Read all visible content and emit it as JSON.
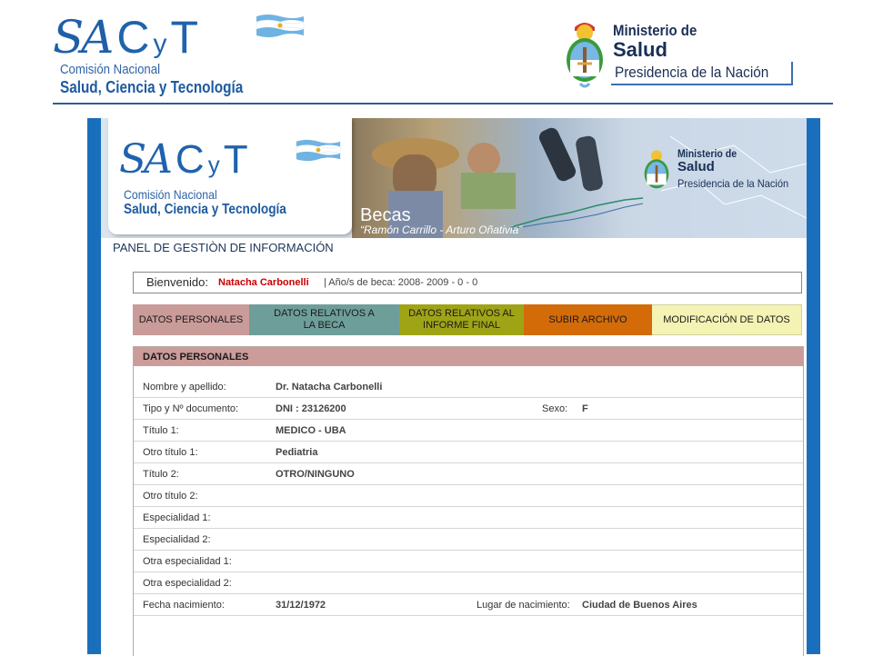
{
  "header": {
    "sacyt_letters": {
      "sa": "SA",
      "c": "C",
      "y": "y",
      "t": "T"
    },
    "sacyt_line1": "Comisión Nacional",
    "sacyt_line2": "Salud, Ciencia y Tecnología",
    "ministerio_line1": "Ministerio de",
    "ministerio_line2": "Salud",
    "ministerio_line3": "Presidencia de la Nación"
  },
  "banner": {
    "sacyt_line1": "Comisión Nacional",
    "sacyt_line2": "Salud, Ciencia y Tecnología",
    "becas_title": "Becas",
    "becas_subtitle": "“Ramón Carrillo - Arturo Oñativia”",
    "ministerio_line1": "Ministerio de",
    "ministerio_line2": "Salud",
    "ministerio_line3": "Presidencia de la Nación"
  },
  "panel_title": "PANEL DE GESTIÒN DE INFORMACIÓN",
  "welcome": {
    "label": "Bienvenido:",
    "name": "Natacha  Carbonelli",
    "years": "| Año/s de beca: 2008- 2009  -  0 - 0"
  },
  "tabs": [
    {
      "label": "DATOS PERSONALES",
      "color": "#c99b99"
    },
    {
      "label": "DATOS RELATIVOS A LA BECA",
      "color": "#6e9e9a"
    },
    {
      "label": "DATOS RELATIVOS AL INFORME FINAL",
      "color": "#9fa316"
    },
    {
      "label": "SUBIR ARCHIVO",
      "color": "#d36b09"
    },
    {
      "label": "MODIFICACIÓN DE DATOS",
      "color": "#f4f3b4"
    }
  ],
  "section": {
    "title": "DATOS PERSONALES",
    "rows": [
      {
        "label": "Nombre y apellido:",
        "value": "Dr.  Natacha  Carbonelli"
      },
      {
        "label": "Tipo y Nº documento:",
        "value": "DNI : 23126200",
        "label2": "Sexo:",
        "value2": "F"
      },
      {
        "label": "Título 1:",
        "value": "MEDICO - UBA"
      },
      {
        "label": "Otro título 1:",
        "value": "Pediatria"
      },
      {
        "label": "Título 2:",
        "value": "OTRO/NINGUNO"
      },
      {
        "label": "Otro título 2:",
        "value": ""
      },
      {
        "label": "Especialidad 1:",
        "value": ""
      },
      {
        "label": "Especialidad 2:",
        "value": ""
      },
      {
        "label": "Otra especialidad 1:",
        "value": ""
      },
      {
        "label": "Otra especialidad 2:",
        "value": ""
      },
      {
        "label": "Fecha nacimiento:",
        "value": "31/12/1972",
        "label2": "Lugar de nacimiento:",
        "value2": "Ciudad de Buenos Aires"
      }
    ]
  },
  "colors": {
    "frame_blue": "#1a6fbd",
    "header_pink": "#cc9c9a",
    "welcome_name_red": "#cc0000",
    "logo_blue": "#1f63ad"
  }
}
